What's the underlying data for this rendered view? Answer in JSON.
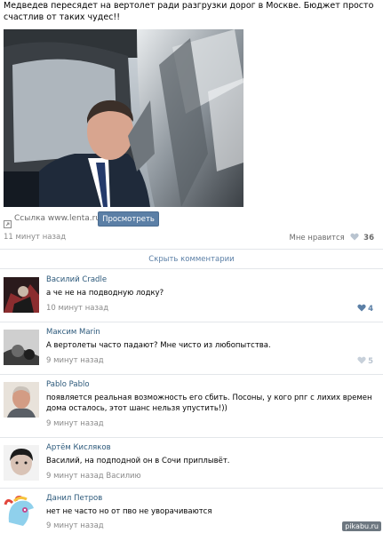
{
  "post": {
    "text": "Медведев пересядет на вертолет ради разгрузки дорог в Москве. Бюджет просто счастлив от таких чудес!!",
    "link_label": "Ссылка www.lenta.ru",
    "view_button": "Просмотреть",
    "time": "11 минут назад",
    "like_label": "Мне нравится",
    "like_count": "36"
  },
  "hide_comments": "Скрыть комментарии",
  "comments": [
    {
      "author": "Василий Cradle",
      "text": "а че не на подводную лодку?",
      "time": "10 минут назад",
      "likes": "4"
    },
    {
      "author": "Максим Marin",
      "text": "А вертолеты часто падают? Мне чисто из любопытства.",
      "time": "9 минут назад",
      "likes": "5"
    },
    {
      "author": "Pablo Pablo",
      "text": "появляется реальная возможность его сбить. Посоны, у кого рпг с лихих времен дома осталось, этот шанс нельзя упустить!))",
      "time": "9 минут назад",
      "likes": ""
    },
    {
      "author": "Артём Кисляков",
      "text": "Василий, на подподной он в Сочи приплывёт.",
      "time": "9 минут назад Василию",
      "likes": ""
    },
    {
      "author": "Данил Петров",
      "text": "нет не часто но от пво не уворачиваются",
      "time": "9 минут назад",
      "likes": ""
    }
  ],
  "watermark": "pikabu.ru",
  "colors": {
    "accent": "#5b7fa6",
    "author": "#2b587a",
    "meta": "#8a8a8a"
  },
  "icons": {
    "link": "link-icon",
    "like": "heart-icon"
  }
}
